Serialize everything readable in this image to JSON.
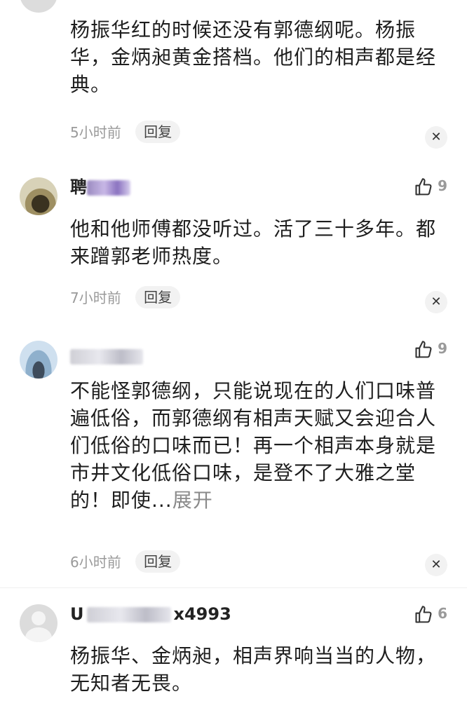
{
  "comments": [
    {
      "text": "杨振华红的时候还没有郭德纲呢。杨振华，金炳昶黄金搭档。他们的相声都是经典。",
      "time": "5小时前",
      "reply_label": "回复"
    },
    {
      "username": "聘",
      "likes": "9",
      "text": "他和他师傅都没听过。活了三十多年。都来蹭郭老师热度。",
      "time": "7小时前",
      "reply_label": "回复"
    },
    {
      "likes": "9",
      "text": "不能怪郭德纲，只能说现在的人们口味普遍低俗，而郭德纲有相声天赋又会迎合人们低俗的口味而已！再一个相声本身就是市井文化低俗口味，是登不了大雅之堂的！即使...",
      "more_label": "展开",
      "time": "6小时前",
      "reply_label": "回复"
    },
    {
      "username_start": "U",
      "username_end": "x4993",
      "likes": "6",
      "text": "杨振华、金炳昶，相声界响当当的人物，无知者无畏。"
    }
  ],
  "icons": {
    "like": "thumbs-up-icon",
    "close": "close-icon"
  },
  "colors": {
    "meta": "#9a9a9a",
    "text": "#1e1e1e",
    "button_bg": "#f2f2f2"
  }
}
